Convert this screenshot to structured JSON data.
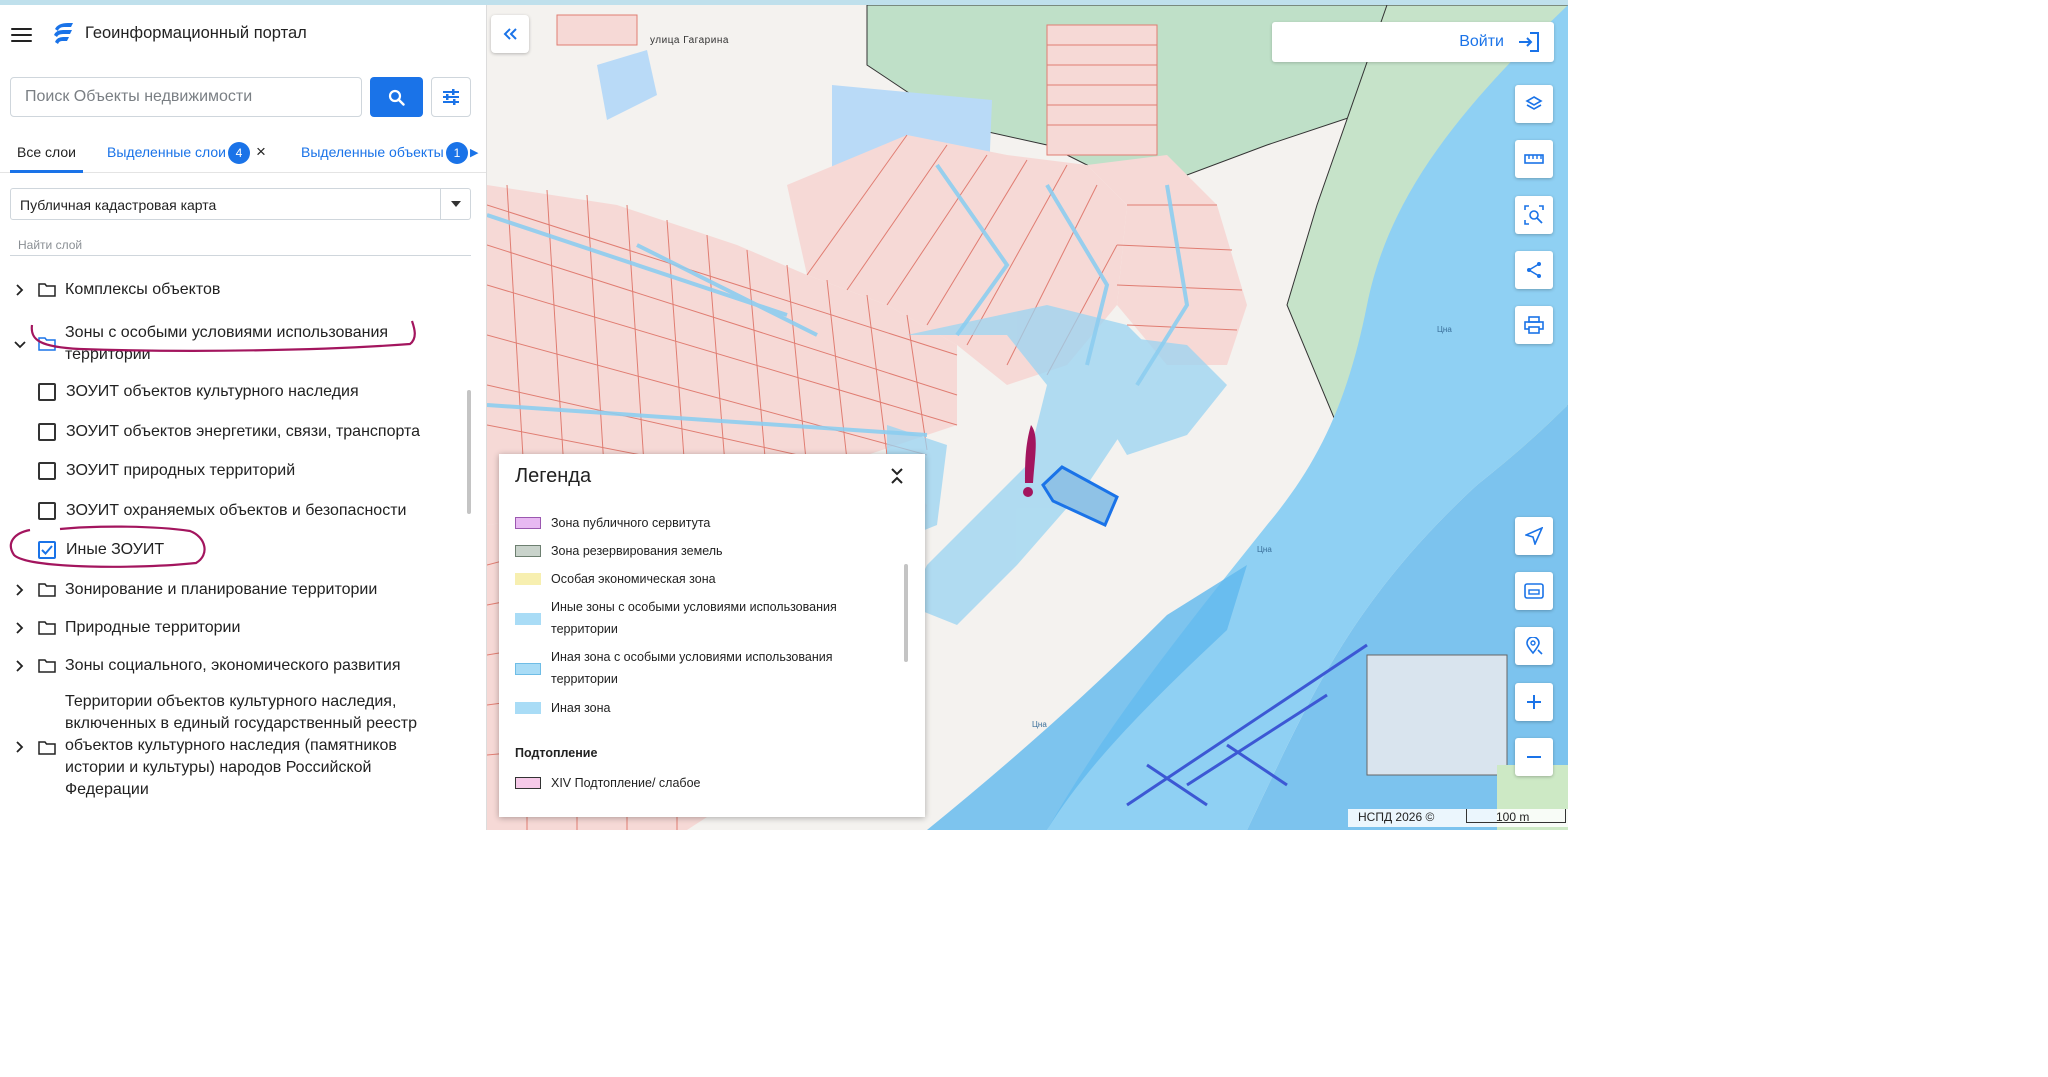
{
  "app": {
    "title": "Геоинформационный портал"
  },
  "search": {
    "placeholder": "Поиск Объекты недвижимости"
  },
  "tabs": {
    "all_layers": "Все слои",
    "selected_layers": "Выделенные слои",
    "selected_layers_count": "4",
    "selected_objects": "Выделенные объекты",
    "selected_objects_count": "1"
  },
  "basemap": {
    "selected": "Публичная кадастровая карта"
  },
  "layer_search": {
    "placeholder": "Найти слой"
  },
  "tree": {
    "complexes": "Комплексы объектов",
    "zouit_group": "Зоны с особыми условиями использования территории",
    "zouit_items": [
      {
        "label": "ЗОУИТ объектов культурного наследия",
        "checked": false
      },
      {
        "label": "ЗОУИТ объектов энергетики, связи, транспорта",
        "checked": false
      },
      {
        "label": "ЗОУИТ природных территорий",
        "checked": false
      },
      {
        "label": "ЗОУИТ охраняемых объектов и безопасности",
        "checked": false
      },
      {
        "label": "Иные ЗОУИТ",
        "checked": true
      }
    ],
    "zoning": "Зонирование и планирование территории",
    "natural": "Природные территории",
    "social": "Зоны социального, экономического развития",
    "heritage": "Территории объектов культурного наследия, включенных в единый государственный реестр объектов культурного наследия (памятников истории и культуры) народов Российской Федерации"
  },
  "map": {
    "street_label": "улица Гагарина",
    "river_label": "Цна",
    "login_label": "Войти",
    "credit": "НСПД 2026 ©",
    "scale": "100 m"
  },
  "legend": {
    "title": "Легенда",
    "items": [
      {
        "label": "Зона публичного сервитута",
        "color": "#e8b9f2"
      },
      {
        "label": "Зона резервирования земель",
        "color": "#c9d3cb"
      },
      {
        "label": "Особая экономическая зона",
        "color": "#f7efb0"
      },
      {
        "label": "Иные зоны с особыми условиями использования территории",
        "color": "#a9dcf6"
      },
      {
        "label": "Иная зона с особыми условиями использования территории",
        "color": "#a9dcf6"
      },
      {
        "label": "Иная зона",
        "color": "#a9dcf6"
      }
    ],
    "section": "Подтопление",
    "section_items": [
      {
        "label": "XIV Подтопление/ слабое",
        "color": "#f6c9e8"
      }
    ]
  },
  "colors": {
    "accent": "#1a73e8",
    "annotation": "#a3155e",
    "parcel_fill": "#f6d9d6",
    "parcel_stroke": "#e07d72",
    "zone_fill": "#9ad4f2",
    "river": "#7cc3ee"
  }
}
